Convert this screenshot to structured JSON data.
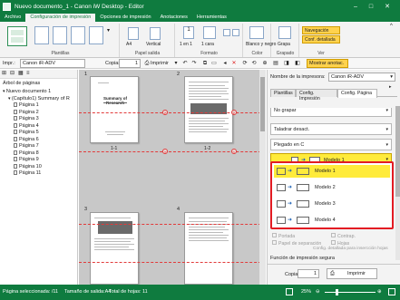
{
  "window": {
    "title": "Nuevo documento_1 - Canon iW Desktop - Editor",
    "controls": [
      "–",
      "□",
      "✕"
    ]
  },
  "menu": {
    "tabs": [
      "Archivo",
      "Configuración de impresión",
      "Opciones de impresión",
      "Anotaciones",
      "Herramientas"
    ],
    "active_index": 1
  },
  "ribbon": {
    "groups": [
      {
        "label": "Plantillas"
      },
      {
        "label": "Papel salida",
        "items": [
          "A4",
          "Vertical"
        ]
      },
      {
        "label": "Formato",
        "items": [
          "1 en 1",
          "1 cara"
        ]
      },
      {
        "label": "Color",
        "items": [
          "Blanco y negro"
        ]
      },
      {
        "label": "Grapado",
        "items": [
          "Grapa"
        ]
      },
      {
        "label": "Ver",
        "items": [
          "Navegación",
          "Conf. detallada"
        ]
      }
    ],
    "template_icon": "template-icon"
  },
  "toolbar": {
    "impr_label": "Impr.:",
    "printer": "Canon iR-ADV",
    "copies_label": "Copias:",
    "copies_value": "1",
    "print_label": "Imprimir",
    "show_annotations": "Mostrar anotac."
  },
  "left_panel": {
    "header": "Árbol de páginas",
    "tree": [
      {
        "label": "Nuevo documento 1",
        "level": 0
      },
      {
        "label": "(Capítulo1) Summary of R",
        "level": 1
      },
      {
        "label": "Página 1",
        "level": 2
      },
      {
        "label": "Página 2",
        "level": 2
      },
      {
        "label": "Página 3",
        "level": 2
      },
      {
        "label": "Página 4",
        "level": 2
      },
      {
        "label": "Página 5",
        "level": 2
      },
      {
        "label": "Página 6",
        "level": 2
      },
      {
        "label": "Página 7",
        "level": 2
      },
      {
        "label": "Página 8",
        "level": 2
      },
      {
        "label": "Página 9",
        "level": 2
      },
      {
        "label": "Página 10",
        "level": 2
      },
      {
        "label": "Página 11",
        "level": 2
      }
    ]
  },
  "center": {
    "pages": [
      {
        "num": "1",
        "label": "1-1",
        "doc_title": "Summary of Research"
      },
      {
        "num": "2",
        "label": "1-2"
      },
      {
        "num": "3",
        "label": ""
      },
      {
        "num": "4",
        "label": ""
      }
    ]
  },
  "right_panel": {
    "printer_label": "Nombre de la impresora:",
    "printer_value": "Canon iR-ADV",
    "tabs": [
      "Plantillas",
      "Config. Impresión",
      "Config. Página"
    ],
    "active_tab": 2,
    "dropdowns": [
      "No grapar",
      "Taladrar desact.",
      "Plegado en C"
    ],
    "model_selected": "Modelo 1",
    "options": [
      "Modelo 1",
      "Modelo 2",
      "Modelo 3",
      "Modelo 4"
    ],
    "checkboxes": [
      "Portada",
      "Contrap.",
      "Papel de separación",
      "Hojas"
    ],
    "link": "Config. detallada para insercción hojas",
    "secure_print": "Función de impresión segura",
    "copies_label": "Copias:",
    "copies_value": "1",
    "print_button": "Imprimir"
  },
  "status": {
    "selected": "Página seleccionada: /11",
    "size": "Tamaño de salida:A4",
    "total": "Total de hojas: 11",
    "zoom": "25%"
  },
  "colors": {
    "accent_green": "#0f7b3f",
    "highlight_red": "#e31b23",
    "selected_yellow": "#ffeb3b"
  }
}
